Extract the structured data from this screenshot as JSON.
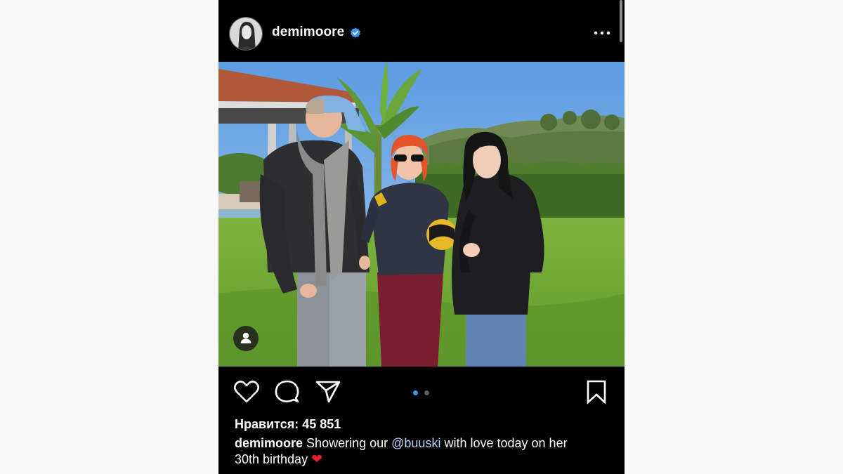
{
  "post": {
    "username": "demimoore",
    "verified": true,
    "likes_label": "Нравится: 45 851",
    "caption": {
      "username": "demimoore",
      "text_before_mention": "Showering our",
      "mention": "@buuski",
      "text_after_mention": "with love today on her",
      "line2": "30th birthday",
      "emoji": "❤"
    },
    "carousel": {
      "current": 1,
      "total": 2
    }
  },
  "icons": {
    "like": "heart-icon",
    "comment": "comment-icon",
    "share": "send-icon",
    "save": "bookmark-icon",
    "more": "more-options-icon",
    "tag": "user-tag-icon"
  },
  "colors": {
    "background": "#000000",
    "verified": "#3897f0",
    "active_dot": "#3897f0",
    "inactive_dot": "#5c5c5c",
    "mention": "#b8d4ff"
  }
}
